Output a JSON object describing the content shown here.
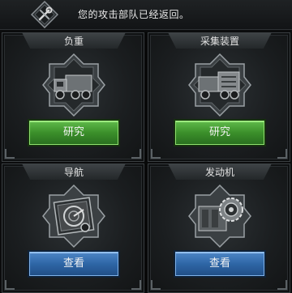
{
  "notification": {
    "icon": "wrench-tools-icon",
    "text": "您的攻击部队已经返回。"
  },
  "colors": {
    "research_button": "#3b8f2a",
    "view_button": "#2e66a6",
    "panel_bg": "#1b1e20"
  },
  "panels": [
    {
      "title": "负重",
      "icon": "cargo-truck-icon",
      "button_label": "研究",
      "button_style": "green"
    },
    {
      "title": "采集装置",
      "icon": "harvester-truck-icon",
      "button_label": "研究",
      "button_style": "green"
    },
    {
      "title": "导航",
      "icon": "navigation-radar-icon",
      "button_label": "查看",
      "button_style": "blue"
    },
    {
      "title": "发动机",
      "icon": "engine-gear-icon",
      "button_label": "查看",
      "button_style": "blue"
    }
  ]
}
